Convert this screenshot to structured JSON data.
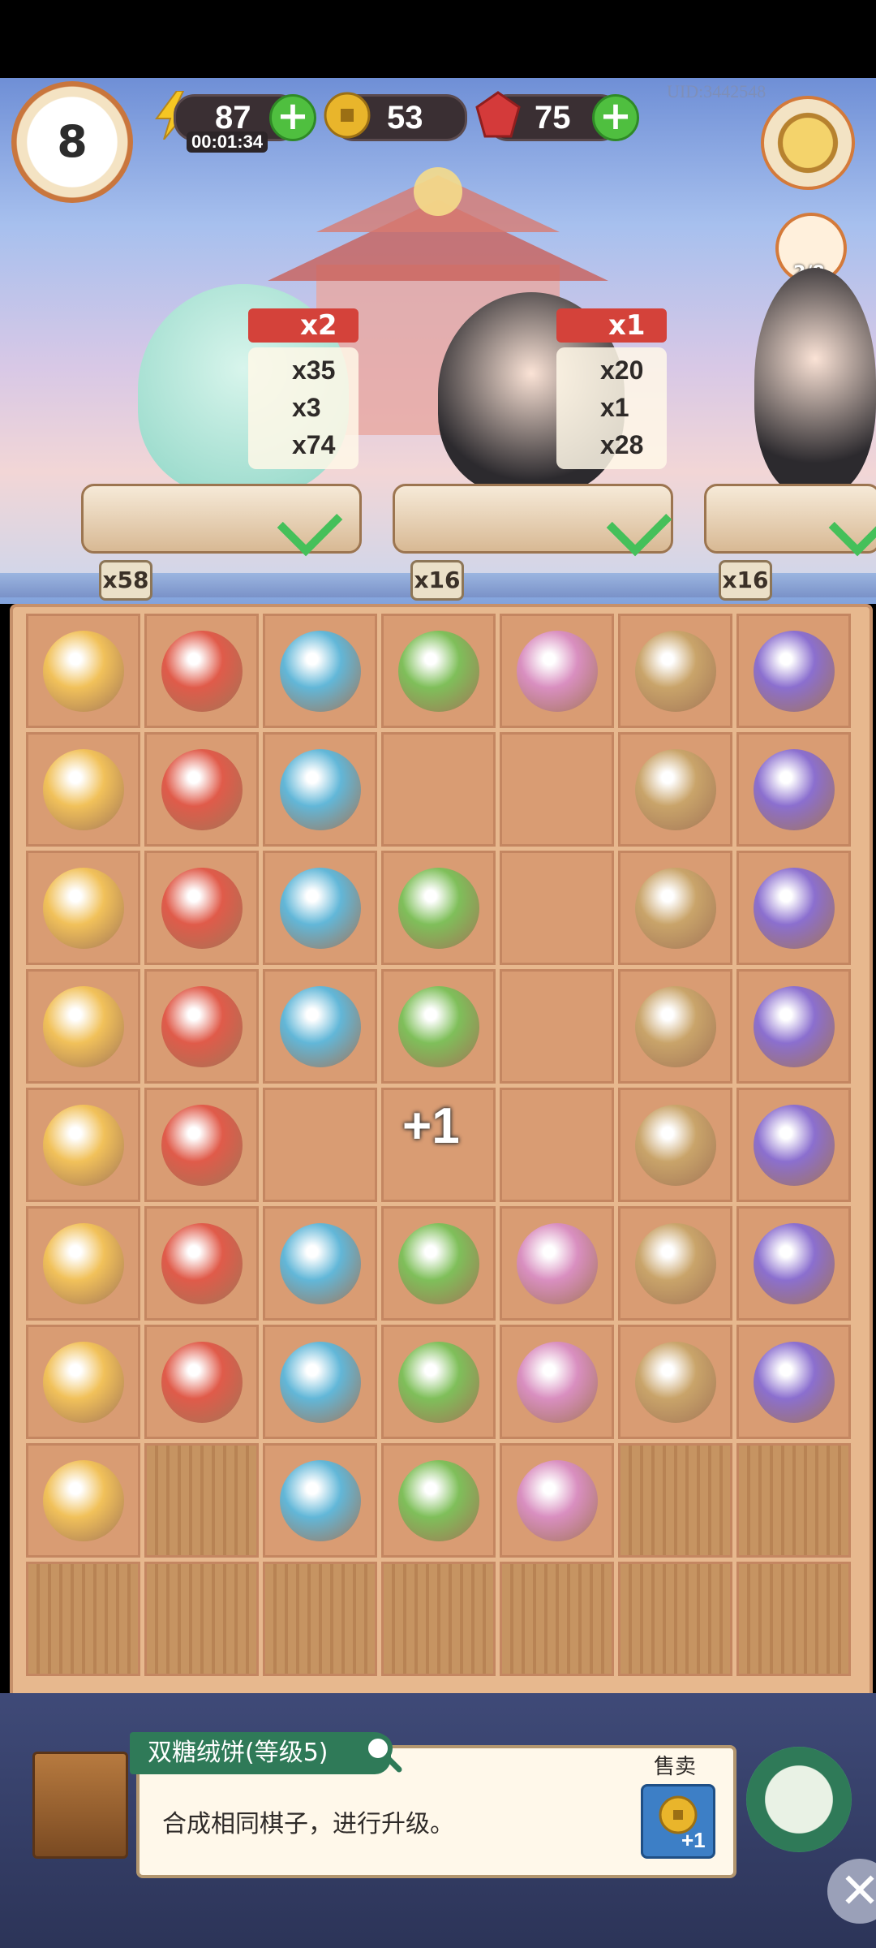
{
  "player": {
    "level": "8",
    "uid": "UID:3442548"
  },
  "resources": {
    "energy": "87",
    "energy_timer": "00:01:34",
    "coins": "53",
    "gems": "75"
  },
  "customers_counter": "2/8",
  "orders": [
    {
      "multiplier": "x2",
      "rewards": [
        "x35",
        "x3",
        "x74"
      ],
      "tray_count": "x58"
    },
    {
      "multiplier": "x1",
      "rewards": [
        "x20",
        "x1",
        "x28"
      ],
      "tray_count": "x16"
    },
    {
      "tray_count": "x16"
    }
  ],
  "merge_popup": "+1",
  "selected_item": {
    "title": "双糖绒饼(等级5)",
    "description": "合成相同棋子，进行升级。",
    "sell_label": "售卖",
    "sell_value": "+1"
  },
  "colors": {
    "energy": "#f5c623",
    "coin": "#e9b52b",
    "gem": "#d43a3a",
    "plus": "#4fbf3f",
    "board": "#d99c73",
    "banner": "#2f7a58",
    "check": "#45c05a"
  },
  "board_icons": [
    [
      "chick-nest-icon",
      "coin-stack-icon",
      "orange-cat-icon",
      "red-box-icon",
      "chicks-nest-icon",
      "red-box-timer-icon",
      "blue-gem-icon"
    ],
    [
      "ring-icon",
      "tabby-cat-icon",
      "herb-bundle-icon",
      "",
      "",
      "watermelon-plate-icon",
      "steamer-basket-icon"
    ],
    [
      "tea-jar-icon",
      "green-box-icon",
      "flower-cake-icon",
      "watermelon-slice-icon",
      "",
      "cotton-bowl-icon",
      "yarn-basket-icon"
    ],
    [
      "coin-pile-icon",
      "two-coins-icon",
      "fruit-platter-icon",
      "watermelon-icon",
      "",
      "brush-icon",
      "scroll-icon"
    ],
    [
      "blue-chest-icon",
      "black-white-cat-icon",
      "",
      "",
      "",
      "teapot-icon",
      "cotton-icon"
    ],
    [
      "tea-cup-icon",
      "bamboo-icon",
      "coin-icon",
      "double-sugar-cake-icon",
      "purple-pouch-icon",
      "cake-roll-icon",
      "flower-pouch-icon"
    ],
    [
      "fan-icon",
      "blue-gem-icon",
      "green-gourd-icon",
      "incense-burner-icon",
      "rice-pot-icon",
      "wooden-box-icon",
      "tea-bowl-icon"
    ],
    [
      "fried-rice-icon",
      "locked",
      "omelette-rice-icon",
      "bracelet-icon",
      "lantern-cage-icon",
      "locked",
      "locked"
    ],
    [
      "locked",
      "locked",
      "locked",
      "locked",
      "locked",
      "locked",
      "locked"
    ]
  ]
}
